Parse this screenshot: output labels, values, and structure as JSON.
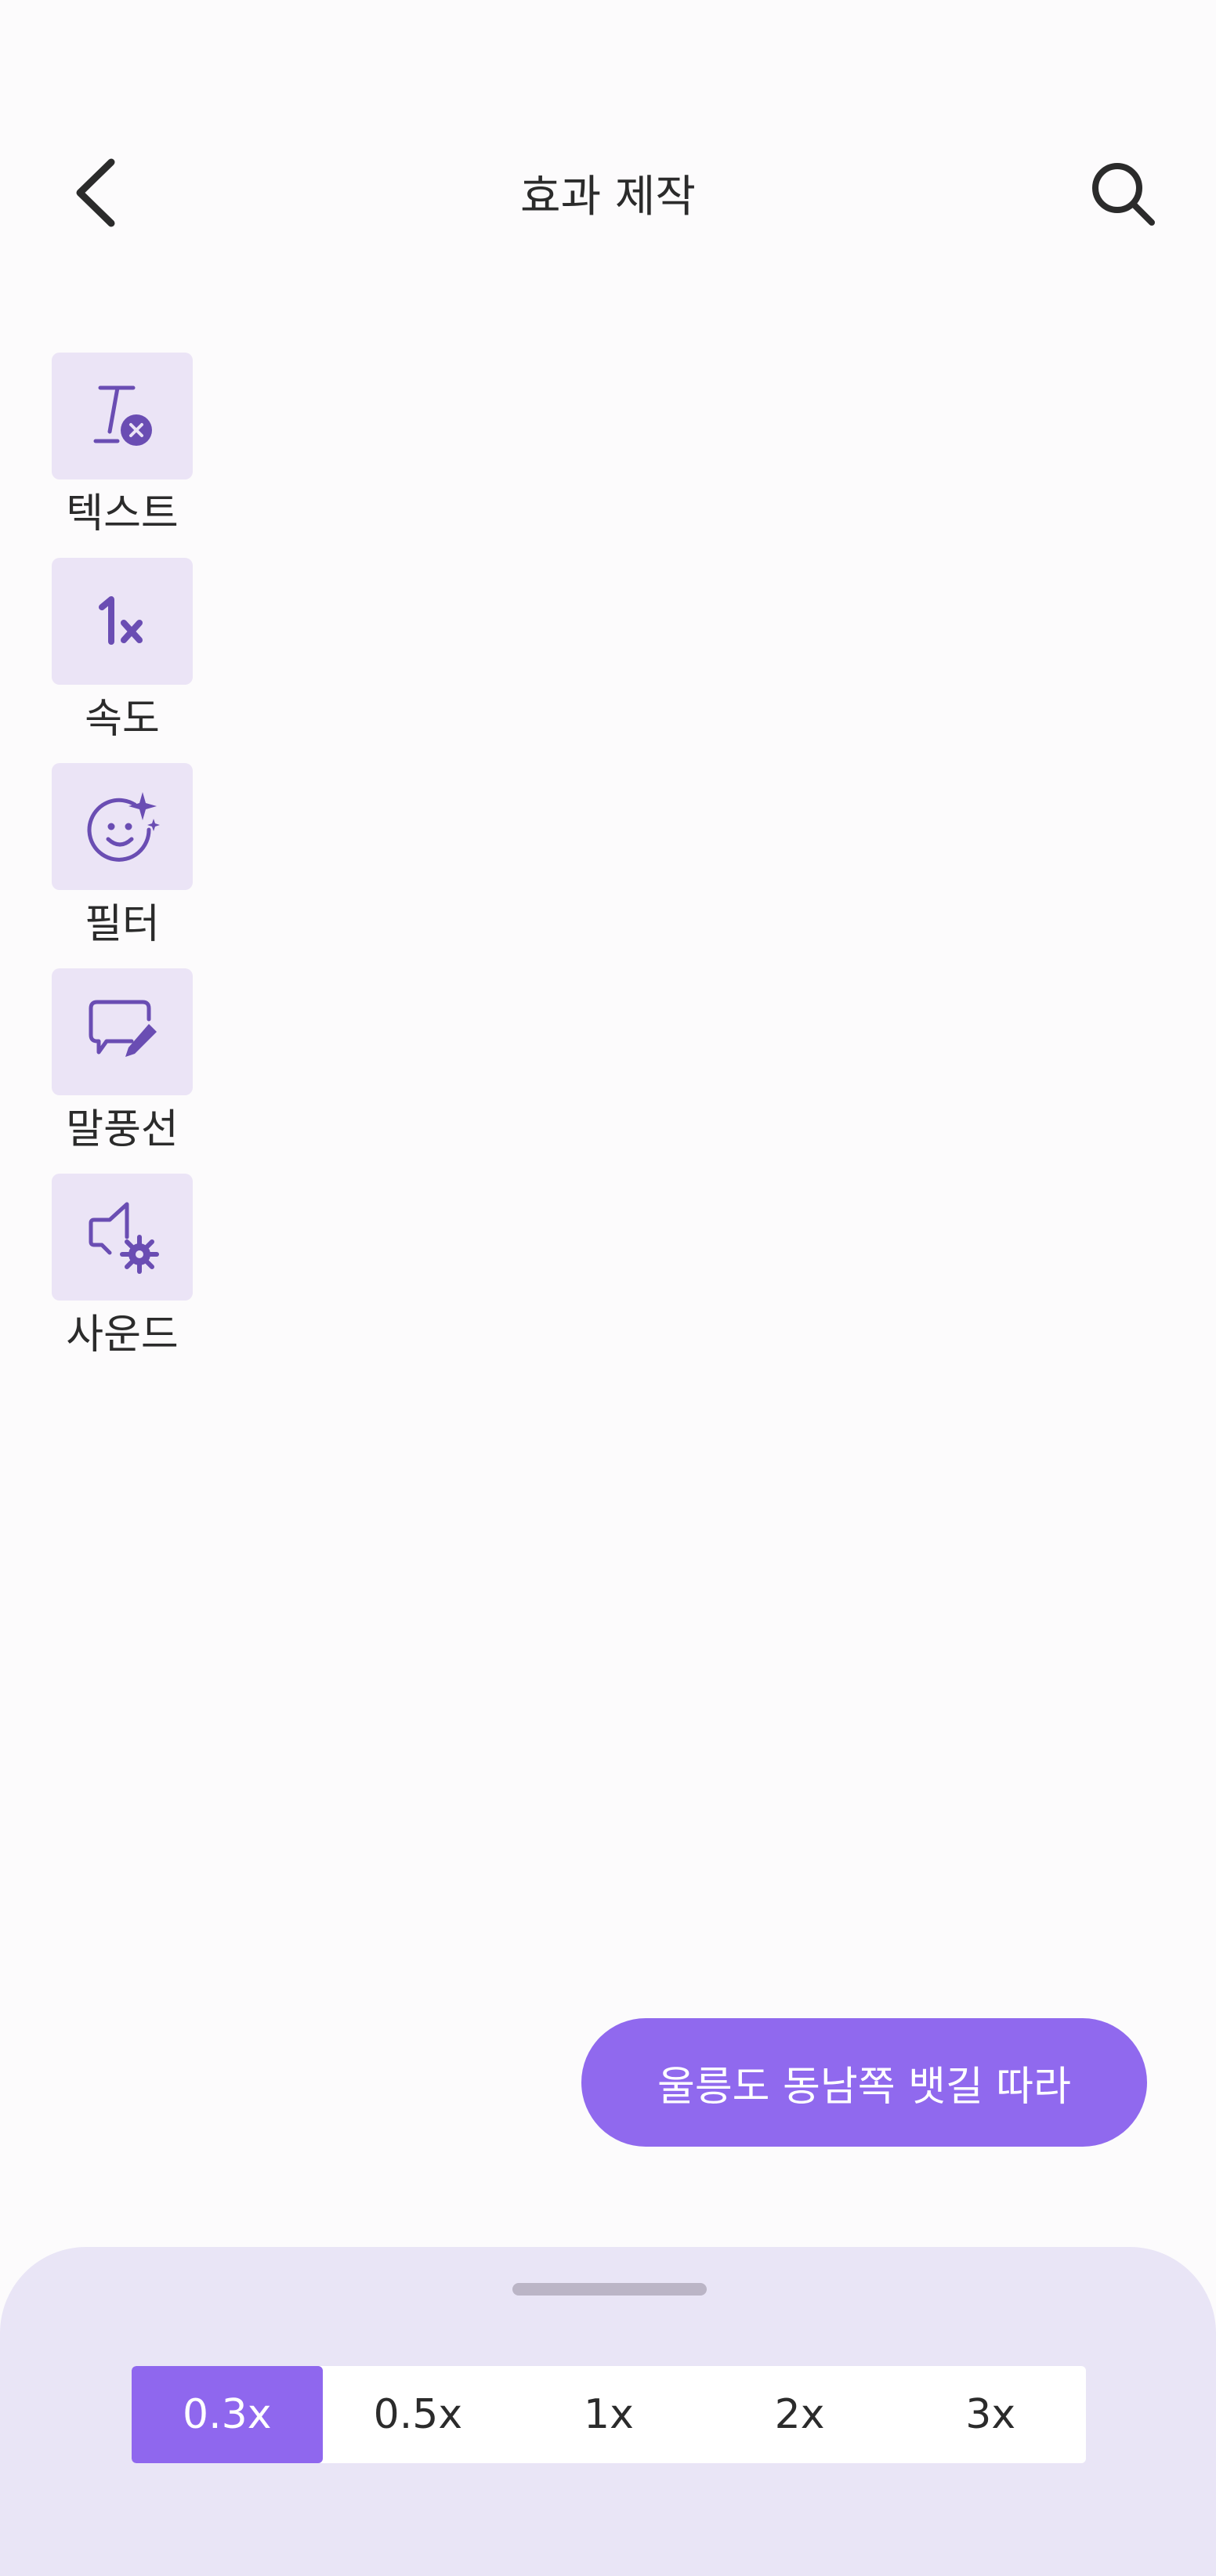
{
  "header": {
    "title": "효과 제작",
    "back_icon": "chevron-left-icon",
    "search_icon": "search-icon"
  },
  "tools": [
    {
      "label": "텍스트",
      "icon": "clear-format-text-icon"
    },
    {
      "label": "속도",
      "icon": "speed-1x-icon"
    },
    {
      "label": "필터",
      "icon": "face-sparkle-icon"
    },
    {
      "label": "말풍선",
      "icon": "speech-bubble-edit-icon"
    },
    {
      "label": "사운드",
      "icon": "speaker-settings-icon"
    }
  ],
  "subtitle_chip": {
    "text": "울릉도 동남쪽 뱃길 따라"
  },
  "speed_selector": {
    "options": [
      "0.3x",
      "0.5x",
      "1x",
      "2x",
      "3x"
    ],
    "selected": "0.3x"
  },
  "colors": {
    "accent": "#9069ee",
    "tile_bg": "#ebe4f6",
    "sheet_bg": "#e9e5f6",
    "icon": "#6a4db3"
  }
}
